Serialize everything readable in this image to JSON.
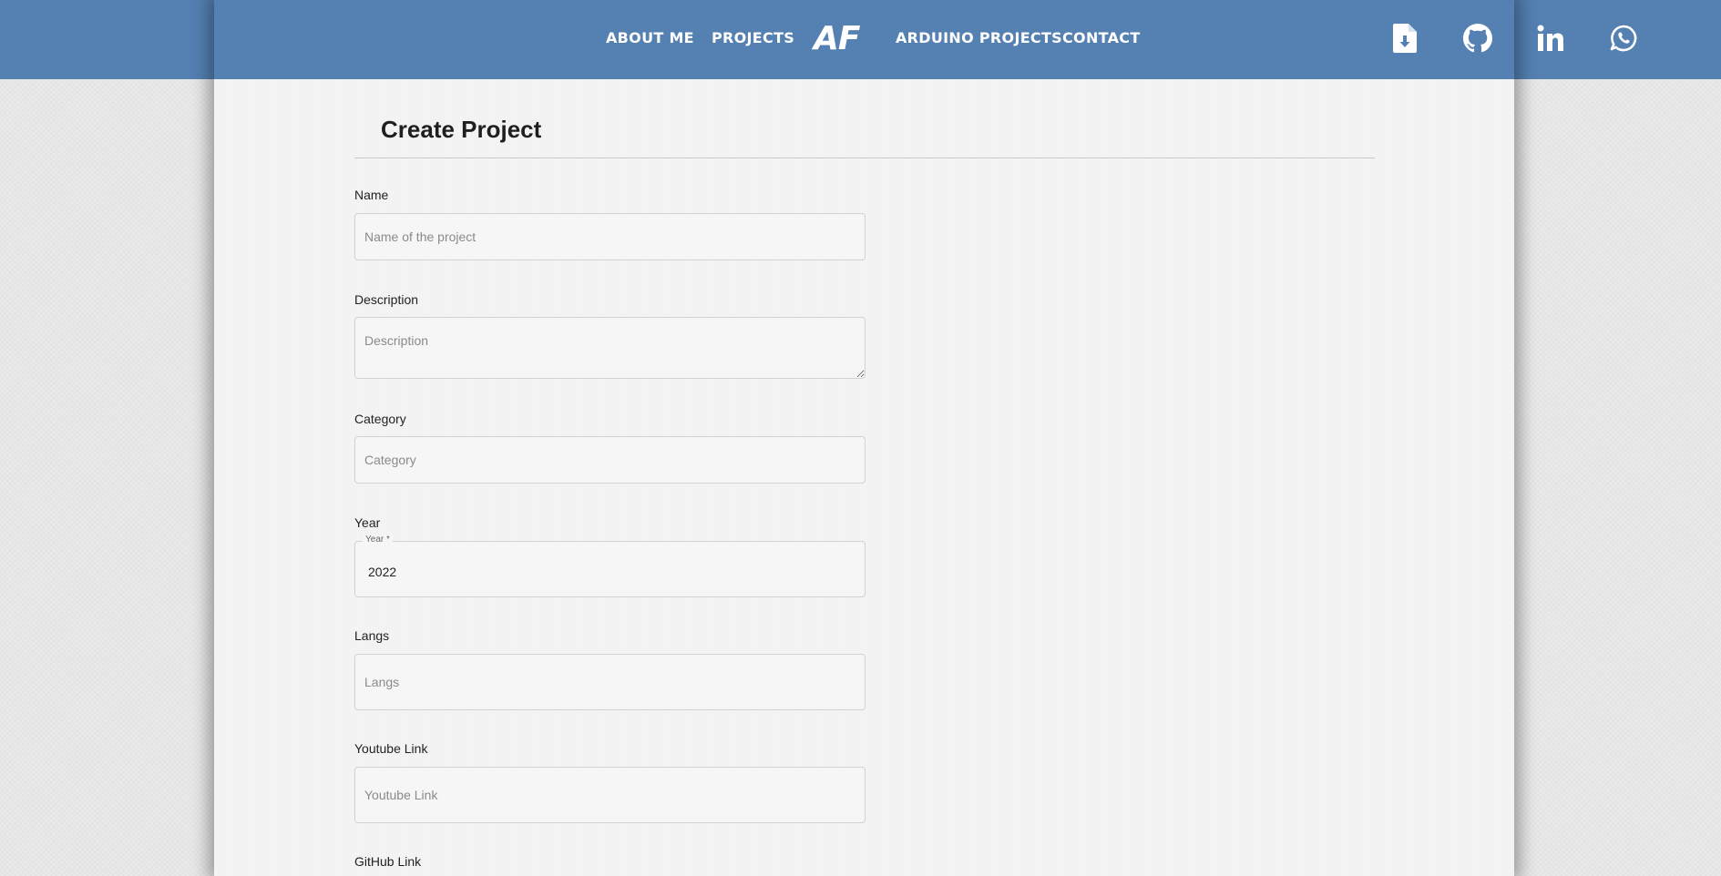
{
  "nav": {
    "links": [
      "ABOUT ME",
      "PROJECTS",
      "ARDUINO PROJECTS",
      "CONTACT"
    ],
    "logo": "AF",
    "icons": [
      "file-download-icon",
      "github-icon",
      "linkedin-icon",
      "whatsapp-icon"
    ]
  },
  "colors": {
    "header": "#5480b2",
    "page_bg": "#f4f4f4",
    "outer_bg": "#e9e9e9"
  },
  "form": {
    "title": "Create Project",
    "name_label": "Name",
    "name_placeholder": "Name of the project",
    "description_label": "Description",
    "description_placeholder": "Description",
    "category_label": "Category",
    "category_placeholder": "Category",
    "year_label": "Year",
    "year_legend": "Year *",
    "year_value": "2022",
    "langs_label": "Langs",
    "langs_placeholder": "Langs",
    "youtube_label": "Youtube Link",
    "youtube_placeholder": "Youtube Link",
    "github_label": "GitHub Link"
  }
}
